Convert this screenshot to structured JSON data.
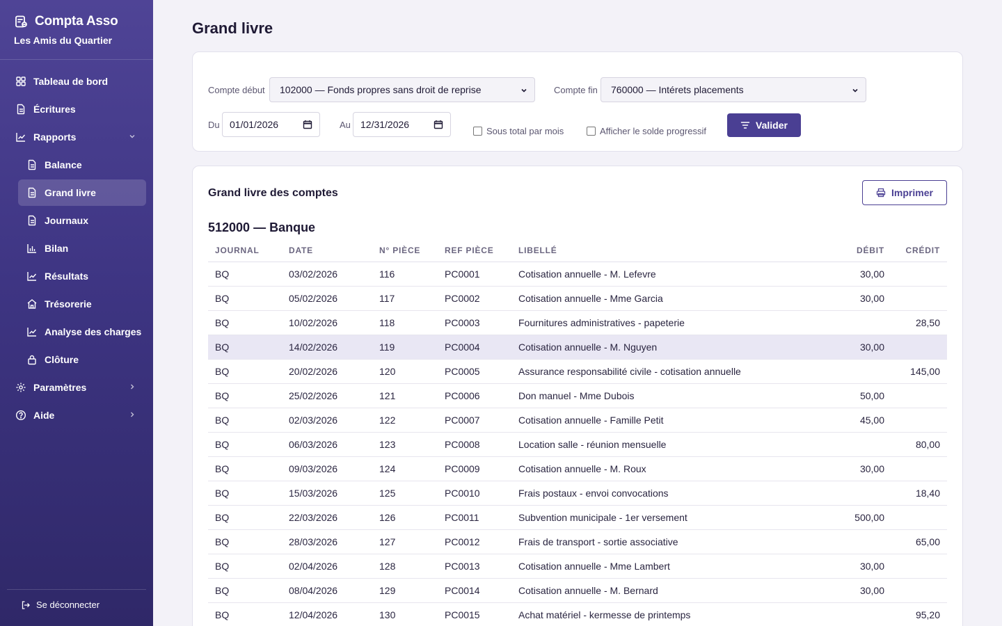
{
  "app": {
    "name": "Compta Asso",
    "organization": "Les Amis du Quartier"
  },
  "sidebar": {
    "items": [
      {
        "label": "Tableau de bord",
        "icon": "dashboard-icon"
      },
      {
        "label": "Écritures",
        "icon": "document-icon"
      },
      {
        "label": "Rapports",
        "icon": "chart-line-icon",
        "expanded": true
      },
      {
        "label": "Balance",
        "icon": "document-icon"
      },
      {
        "label": "Grand livre",
        "icon": "document-icon",
        "active": true
      },
      {
        "label": "Journaux",
        "icon": "document-icon"
      },
      {
        "label": "Bilan",
        "icon": "bar-chart-icon"
      },
      {
        "label": "Résultats",
        "icon": "chart-line-icon"
      },
      {
        "label": "Trésorerie",
        "icon": "home-icon"
      },
      {
        "label": "Analyse des charges",
        "icon": "chart-line-icon"
      },
      {
        "label": "Clôture",
        "icon": "lock-icon"
      },
      {
        "label": "Paramètres",
        "icon": "gear-icon"
      },
      {
        "label": "Aide",
        "icon": "help-icon"
      }
    ],
    "logout_label": "Se déconnecter"
  },
  "page": {
    "title": "Grand livre"
  },
  "filters": {
    "account_start_label": "Compte début",
    "account_start_value": "102000 — Fonds propres sans droit de reprise",
    "account_end_label": "Compte fin",
    "account_end_value": "760000 — Intérets placements",
    "date_from_label": "Du",
    "date_from_value": "01/01/2026",
    "date_to_label": "Au",
    "date_to_value": "12/31/2026",
    "subtotal_label": "Sous total par mois",
    "subtotal_checked": false,
    "running_balance_label": "Afficher le solde progressif",
    "running_balance_checked": false,
    "validate_label": "Valider"
  },
  "ledger": {
    "title": "Grand livre des comptes",
    "print_label": "Imprimer",
    "account_title": "512000 — Banque",
    "columns": [
      "JOURNAL",
      "DATE",
      "N° PIÈCE",
      "REF PIÈCE",
      "LIBELLÉ",
      "DÉBIT",
      "CRÉDIT"
    ],
    "rows": [
      [
        "BQ",
        "03/02/2026",
        "116",
        "PC0001",
        "Cotisation annuelle - M. Lefevre",
        "30,00",
        ""
      ],
      [
        "BQ",
        "05/02/2026",
        "117",
        "PC0002",
        "Cotisation annuelle - Mme Garcia",
        "30,00",
        ""
      ],
      [
        "BQ",
        "10/02/2026",
        "118",
        "PC0003",
        "Fournitures administratives - papeterie",
        "",
        "28,50"
      ],
      [
        "BQ",
        "14/02/2026",
        "119",
        "PC0004",
        "Cotisation annuelle - M. Nguyen",
        "30,00",
        ""
      ],
      [
        "BQ",
        "20/02/2026",
        "120",
        "PC0005",
        "Assurance responsabilité civile - cotisation annuelle",
        "",
        "145,00"
      ],
      [
        "BQ",
        "25/02/2026",
        "121",
        "PC0006",
        "Don manuel - Mme Dubois",
        "50,00",
        ""
      ],
      [
        "BQ",
        "02/03/2026",
        "122",
        "PC0007",
        "Cotisation annuelle - Famille Petit",
        "45,00",
        ""
      ],
      [
        "BQ",
        "06/03/2026",
        "123",
        "PC0008",
        "Location salle - réunion mensuelle",
        "",
        "80,00"
      ],
      [
        "BQ",
        "09/03/2026",
        "124",
        "PC0009",
        "Cotisation annuelle - M. Roux",
        "30,00",
        ""
      ],
      [
        "BQ",
        "15/03/2026",
        "125",
        "PC0010",
        "Frais postaux - envoi convocations",
        "",
        "18,40"
      ],
      [
        "BQ",
        "22/03/2026",
        "126",
        "PC0011",
        "Subvention municipale - 1er versement",
        "500,00",
        ""
      ],
      [
        "BQ",
        "28/03/2026",
        "127",
        "PC0012",
        "Frais de transport - sortie associative",
        "",
        "65,00"
      ],
      [
        "BQ",
        "02/04/2026",
        "128",
        "PC0013",
        "Cotisation annuelle - Mme Lambert",
        "30,00",
        ""
      ],
      [
        "BQ",
        "08/04/2026",
        "129",
        "PC0014",
        "Cotisation annuelle - M. Bernard",
        "30,00",
        ""
      ],
      [
        "BQ",
        "12/04/2026",
        "130",
        "PC0015",
        "Achat matériel - kermesse de printemps",
        "",
        "95,20"
      ]
    ]
  }
}
